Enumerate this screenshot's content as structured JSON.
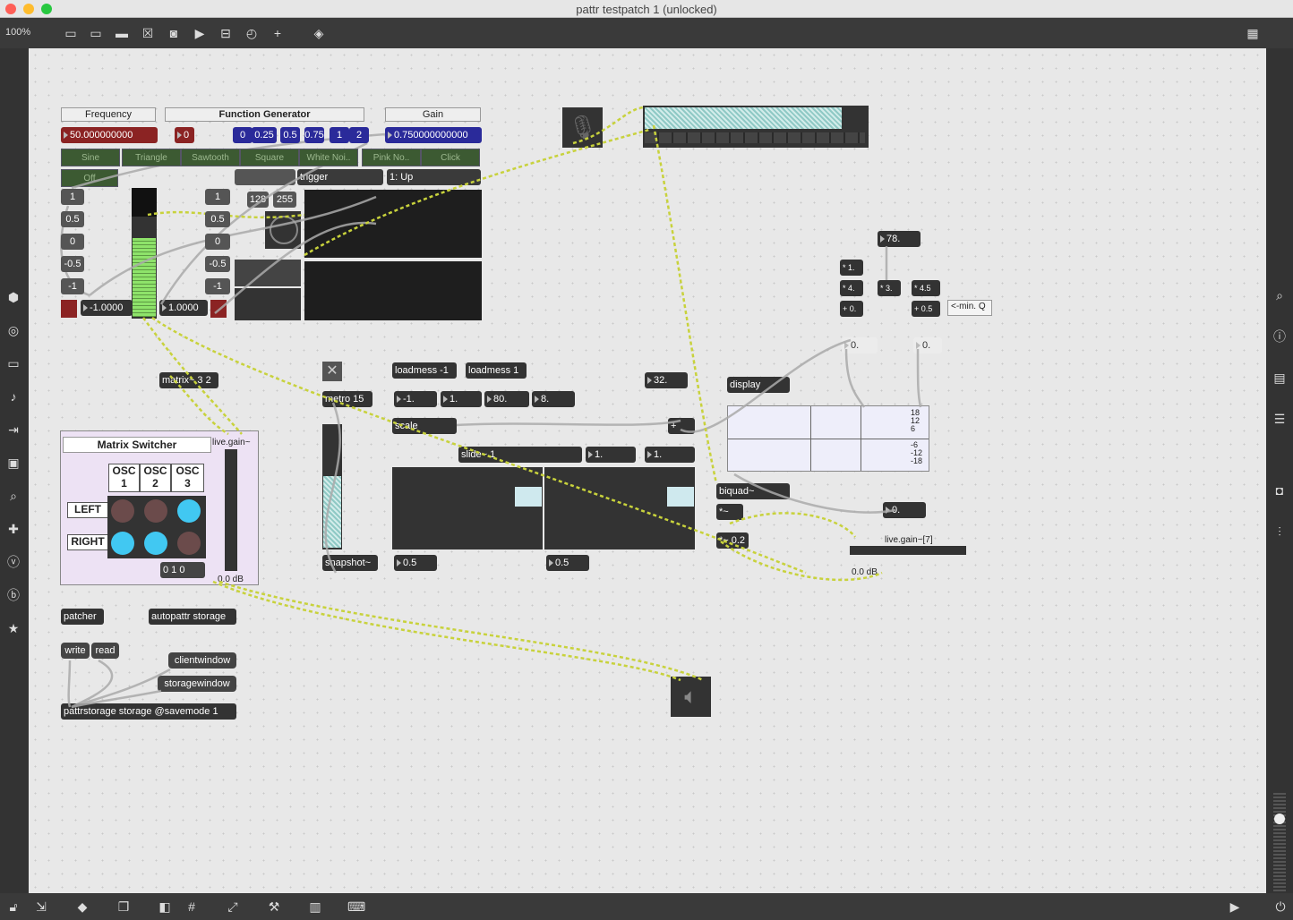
{
  "window": {
    "title": "pattr testpatch 1 (unlocked)"
  },
  "toolbar": {
    "zoom": "100%"
  },
  "headers": {
    "frequency": "Frequency",
    "function_generator": "Function Generator",
    "gain": "Gain"
  },
  "freq_value": "50.000000000",
  "freq_small": "0",
  "preset_values": [
    "0",
    "0.25",
    "0.5",
    "0.75",
    "1",
    "2"
  ],
  "gain_value": "0.750000000000",
  "waveform_tabs": [
    "Sine",
    "Triangle",
    "Sawtooth",
    "Square",
    "White Noi..",
    "Pink No..",
    "Click"
  ],
  "off_label": "Off",
  "trigger_label": "trigger",
  "mode_menu": "1: Up",
  "left_column": [
    "1",
    "0.5",
    "0",
    "-0.5",
    "-1"
  ],
  "left_readout": "-1.0000",
  "mid_column": [
    "1",
    "0.5",
    "0",
    "-0.5",
    "-1"
  ],
  "mid_readout": "1.0000",
  "small_nums": [
    "128",
    "255"
  ],
  "matrix_obj": "matrix~ 3 2",
  "matrix_switcher": {
    "title": "Matrix Switcher",
    "cols": [
      "OSC 1",
      "OSC 2",
      "OSC 3"
    ],
    "rows": [
      "LEFT",
      "RIGHT"
    ],
    "state": "0 1 0",
    "gain_label": "live.gain~",
    "db": "0.0 dB"
  },
  "patcher_label": "patcher",
  "autopattr_label": "autopattr storage",
  "write_label": "write",
  "read_label": "read",
  "clientwindow_label": "clientwindow",
  "storagewindow_label": "storagewindow",
  "pattrstorage_label": "pattrstorage storage @savemode 1",
  "metro_label": "metro 15",
  "snapshot_label": "snapshot~",
  "loadmess_a": "loadmess -1",
  "loadmess_b": "loadmess 1",
  "scale_nums": [
    "-1.",
    "1.",
    "80.",
    "8."
  ],
  "scale_label": "scale",
  "slide_label": "slide~ 1",
  "slide_nums": [
    "1.",
    "1."
  ],
  "scope_vals": [
    "0.5",
    "0.5"
  ],
  "plus_label": "+",
  "val_32": "32.",
  "display_menu": "display",
  "filter_db_ticks": [
    "18",
    "12",
    "6",
    "-6",
    "-12",
    "-18"
  ],
  "biquad_label": "biquad~",
  "times_label": "*~",
  "times_02": "*~ 0.2",
  "gain7_label": "live.gain~[7]",
  "gain7_db": "0.0 dB",
  "val_0": "0.",
  "val_78": "78.",
  "ops": [
    "* 1.",
    "* 4.",
    "+ 0.",
    "* 3.",
    "* 4.5",
    "+ 0.5"
  ],
  "minq_comment": "<-min. Q",
  "filter_params": [
    "0.",
    "0."
  ],
  "colors": {
    "canvas": "#e8e8e8",
    "object": "#333333",
    "accent_cyan": "#41c8f2",
    "cable_yellow": "#c8d23c",
    "meter_green": "#8ee36a"
  }
}
